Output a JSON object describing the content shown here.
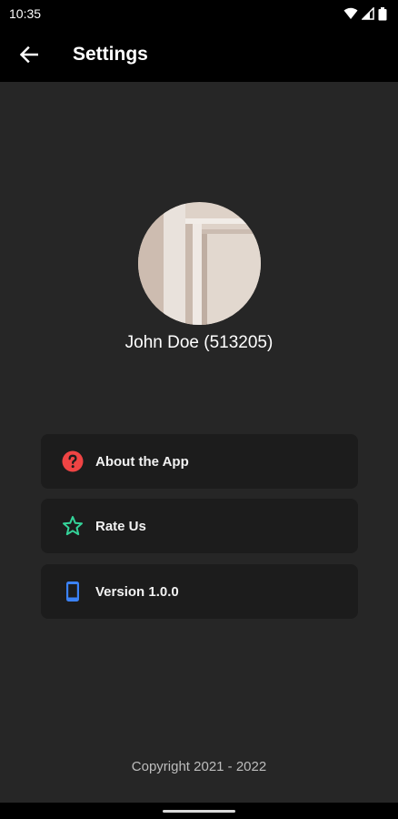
{
  "status_bar": {
    "time": "10:35"
  },
  "app_bar": {
    "title": "Settings",
    "back_icon": "arrow-back-icon"
  },
  "profile": {
    "name": "John Doe (513205)"
  },
  "menu": {
    "items": [
      {
        "label": "About the App",
        "icon": "help-circle-icon",
        "color": "#ef4444"
      },
      {
        "label": "Rate Us",
        "icon": "star-outline-icon",
        "color": "#34d399"
      },
      {
        "label": "Version 1.0.0",
        "icon": "phone-icon",
        "color": "#3b82f6"
      }
    ]
  },
  "footer": {
    "copyright": "Copyright 2021 - 2022"
  },
  "colors": {
    "background": "#262626",
    "app_bar": "#000000",
    "card": "#1c1c1c"
  }
}
